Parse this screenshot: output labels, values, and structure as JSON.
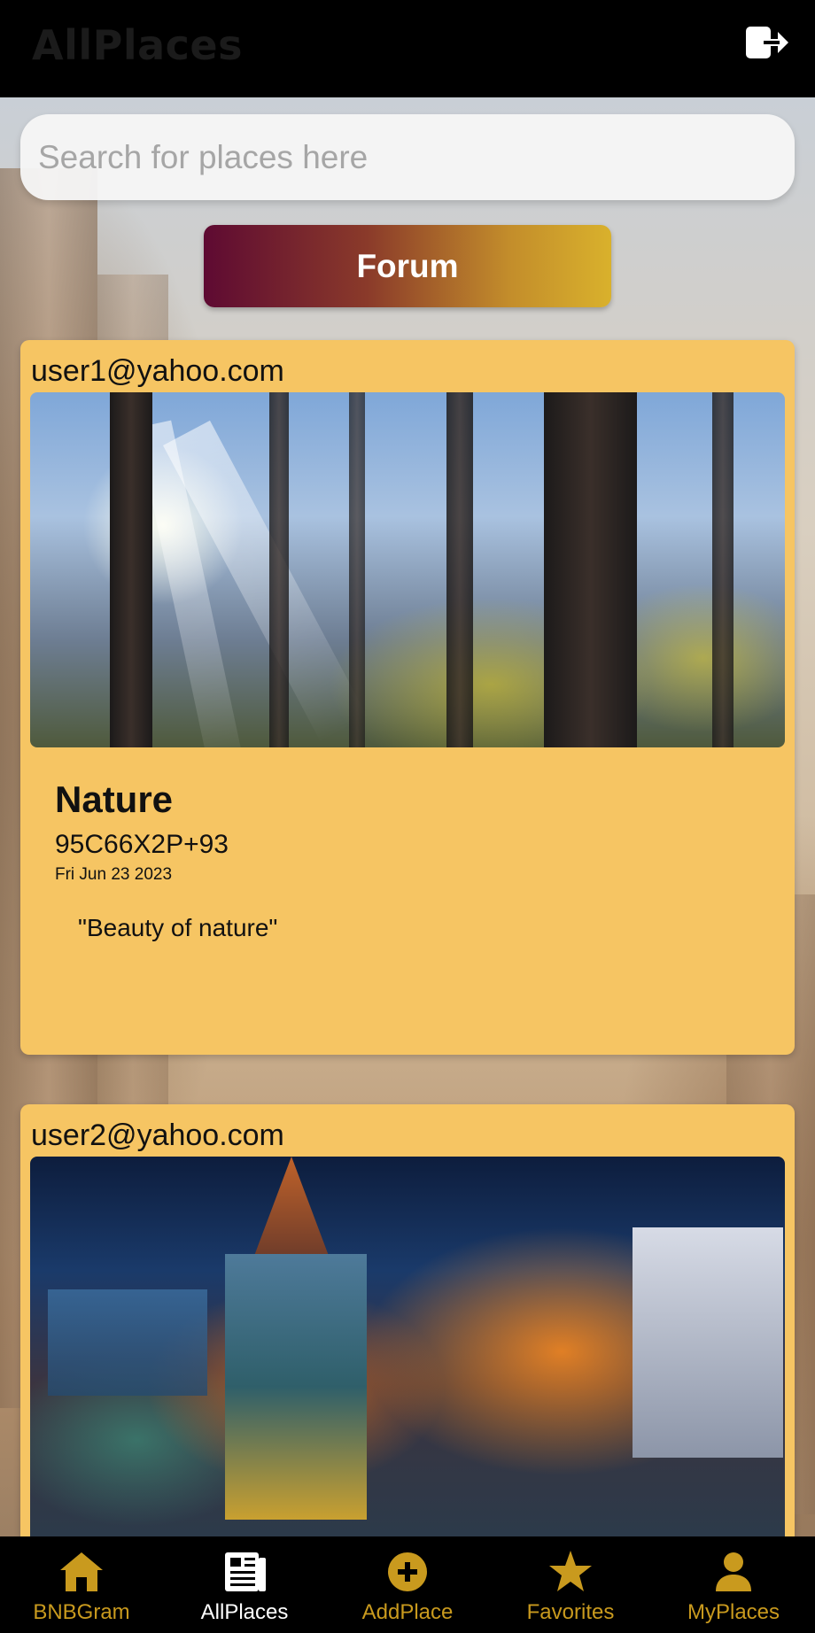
{
  "header": {
    "title": "AllPlaces",
    "logout_icon": "logout-icon"
  },
  "search": {
    "placeholder": "Search for places here",
    "value": ""
  },
  "forum_button": {
    "label": "Forum"
  },
  "posts": [
    {
      "user": "user1@yahoo.com",
      "image": "forest-sunlight-photo",
      "name": "Nature",
      "code": "95C66X2P+93",
      "date": "Fri Jun 23 2023",
      "description": "\"Beauty of nature\""
    },
    {
      "user": "user2@yahoo.com",
      "image": "city-night-aerial-photo"
    }
  ],
  "tabs": [
    {
      "label": "BNBGram",
      "icon": "home-icon",
      "active": false
    },
    {
      "label": "AllPlaces",
      "icon": "newspaper-icon",
      "active": true
    },
    {
      "label": "AddPlace",
      "icon": "add-circle-icon",
      "active": false
    },
    {
      "label": "Favorites",
      "icon": "star-icon",
      "active": false
    },
    {
      "label": "MyPlaces",
      "icon": "person-icon",
      "active": false
    }
  ],
  "colors": {
    "card": "#f6c563",
    "tab_inactive": "#c99a1e",
    "tab_active": "#ffffff",
    "forum_gradient_start": "#5e0a32",
    "forum_gradient_end": "#d9b12c"
  }
}
